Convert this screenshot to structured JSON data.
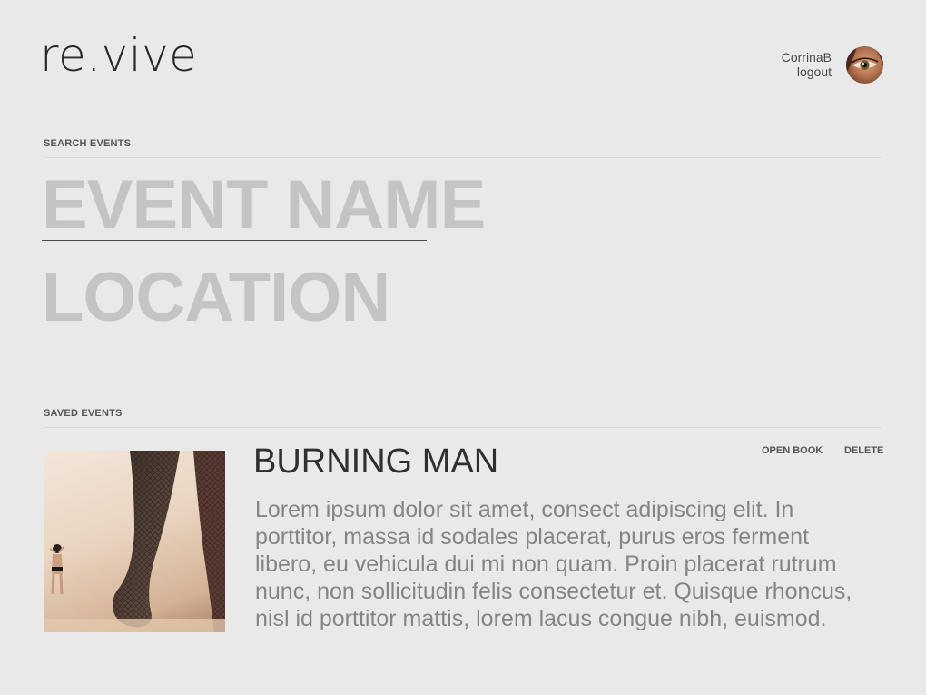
{
  "header": {
    "logo_text": "re.vive",
    "username": "CorrinaB",
    "logout_label": "logout"
  },
  "search": {
    "section_label": "SEARCH EVENTS",
    "event_name_placeholder": "EVENT NAME",
    "location_placeholder": "LOCATION"
  },
  "saved": {
    "section_label": "SAVED EVENTS",
    "events": [
      {
        "title": "BURNING MAN",
        "description": "Lorem ipsum dolor sit amet, consect adipiscing elit. In porttitor, massa id sodales placerat, purus eros ferment libero, eu vehicula dui mi non quam. Proin placerat rutrum nunc, non sollicitudin felis consectetur et. Quisque rhoncus, nisl id porttitor mattis, lorem lacus congue nibh, euismod.",
        "open_label": "OPEN BOOK",
        "delete_label": "DELETE"
      }
    ]
  }
}
